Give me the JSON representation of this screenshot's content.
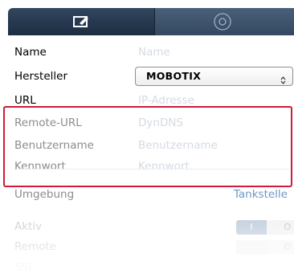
{
  "tabs": [
    {
      "icon": "edit-icon"
    },
    {
      "icon": "disc-icon"
    }
  ],
  "form": {
    "name": {
      "label": "Name",
      "placeholder": "Name"
    },
    "manufacturer": {
      "label": "Hersteller",
      "value": "MOBOTIX"
    },
    "url": {
      "label": "URL",
      "placeholder": "IP-Adresse"
    },
    "remote_url": {
      "label": "Remote-URL",
      "placeholder": "DynDNS"
    },
    "username": {
      "label": "Benutzername",
      "placeholder": "Benutzername"
    },
    "password": {
      "label": "Kennwort",
      "placeholder": "Kennwort"
    },
    "environment": {
      "label": "Umgebung",
      "value": "Tankstelle"
    },
    "active": {
      "label": "Aktiv",
      "on": "I",
      "off": "O"
    },
    "remote": {
      "label": "Remote",
      "off": "O"
    },
    "ssl": {
      "label": "SSL"
    }
  },
  "colors": {
    "highlight": "#d21a3a",
    "tab_bar": "#1d2d42",
    "link": "#6d98c4"
  }
}
